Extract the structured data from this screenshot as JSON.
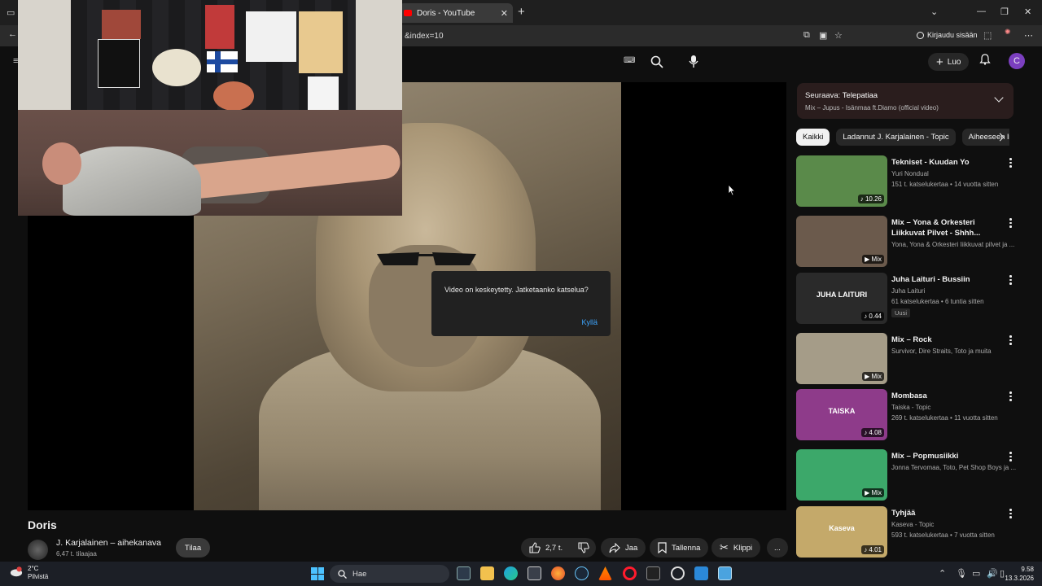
{
  "browser": {
    "tab_title": "Doris - YouTube",
    "new_tab": "+",
    "tab_close": "✕",
    "url_fragment": "&index=10",
    "login_label": "Kirjaudu sisään"
  },
  "youtube": {
    "create_label": "Luo",
    "avatar_letter": "C"
  },
  "player": {
    "dialog_message": "Video on keskeytetty. Jatketaanko katselua?",
    "dialog_yes": "Kyllä"
  },
  "upnext": {
    "label": "Seuraava:",
    "title": "Telepatiaa",
    "subtitle": "Mix – Jupus - Isänmaa ft.Diamo (official video)"
  },
  "chips": [
    "Kaikki",
    "Ladannut J. Karjalainen - Topic",
    "Aiheeseen liittyvät"
  ],
  "videos": [
    {
      "title": "Tekniset - Kuudan Yo",
      "channel": "Yuri Nondual",
      "meta": "151 t. katselukertaa • 14 vuotta sitten",
      "badge": "♪ 10.26",
      "new": "",
      "thumb_color": "#5a8a4a"
    },
    {
      "title": "Mix – Yona & Orkesteri Liikkuvat Pilvet - Shhh...",
      "channel": "Yona, Yona & Orkesteri liikkuvat pilvet ja ...",
      "meta": "",
      "badge": "▶ Mix",
      "new": "",
      "thumb_color": "#6b5a4c"
    },
    {
      "title": "Juha Laituri - Bussiin",
      "channel": "Juha Laituri",
      "meta": "61 katselukertaa • 6 tuntia sitten",
      "badge": "♪ 0.44",
      "new": "Uusi",
      "thumb_color": "#2a2a2a",
      "thumb_text": "JUHA LAITURI"
    },
    {
      "title": "Mix – Rock",
      "channel": "Survivor, Dire Straits, Toto ja muita",
      "meta": "",
      "badge": "▶ Mix",
      "new": "",
      "thumb_color": "#a59c88"
    },
    {
      "title": "Mombasa",
      "channel": "Taiska - Topic",
      "meta": "269 t. katselukertaa • 11 vuotta sitten",
      "badge": "♪ 4.08",
      "new": "",
      "thumb_color": "#8e3b8a",
      "thumb_text": "TAISKA"
    },
    {
      "title": "Mix – Popmusiikki",
      "channel": "Jonna Tervomaa, Toto, Pet Shop Boys ja ...",
      "meta": "",
      "badge": "▶ Mix",
      "new": "",
      "thumb_color": "#3ca86a"
    },
    {
      "title": "Tyhjää",
      "channel": "Kaseva - Topic",
      "meta": "593 t. katselukertaa • 7 vuotta sitten",
      "badge": "♪ 4.01",
      "new": "",
      "thumb_color": "#c4a96a",
      "thumb_text": "Kaseva"
    }
  ],
  "video": {
    "title": "Doris",
    "channel_name": "J. Karjalainen – aihekanava",
    "subscribers": "6,47 t. tilaajaa",
    "subscribe_label": "Tilaa",
    "likes": "2,7 t.",
    "share_label": "Jaa",
    "save_label": "Tallenna",
    "clip_label": "Klippi",
    "more_label": "..."
  },
  "taskbar": {
    "temperature": "2°C",
    "weather": "Pilvistä",
    "search_label": "Hae",
    "time": "9.58",
    "date": "13.3.2026"
  }
}
